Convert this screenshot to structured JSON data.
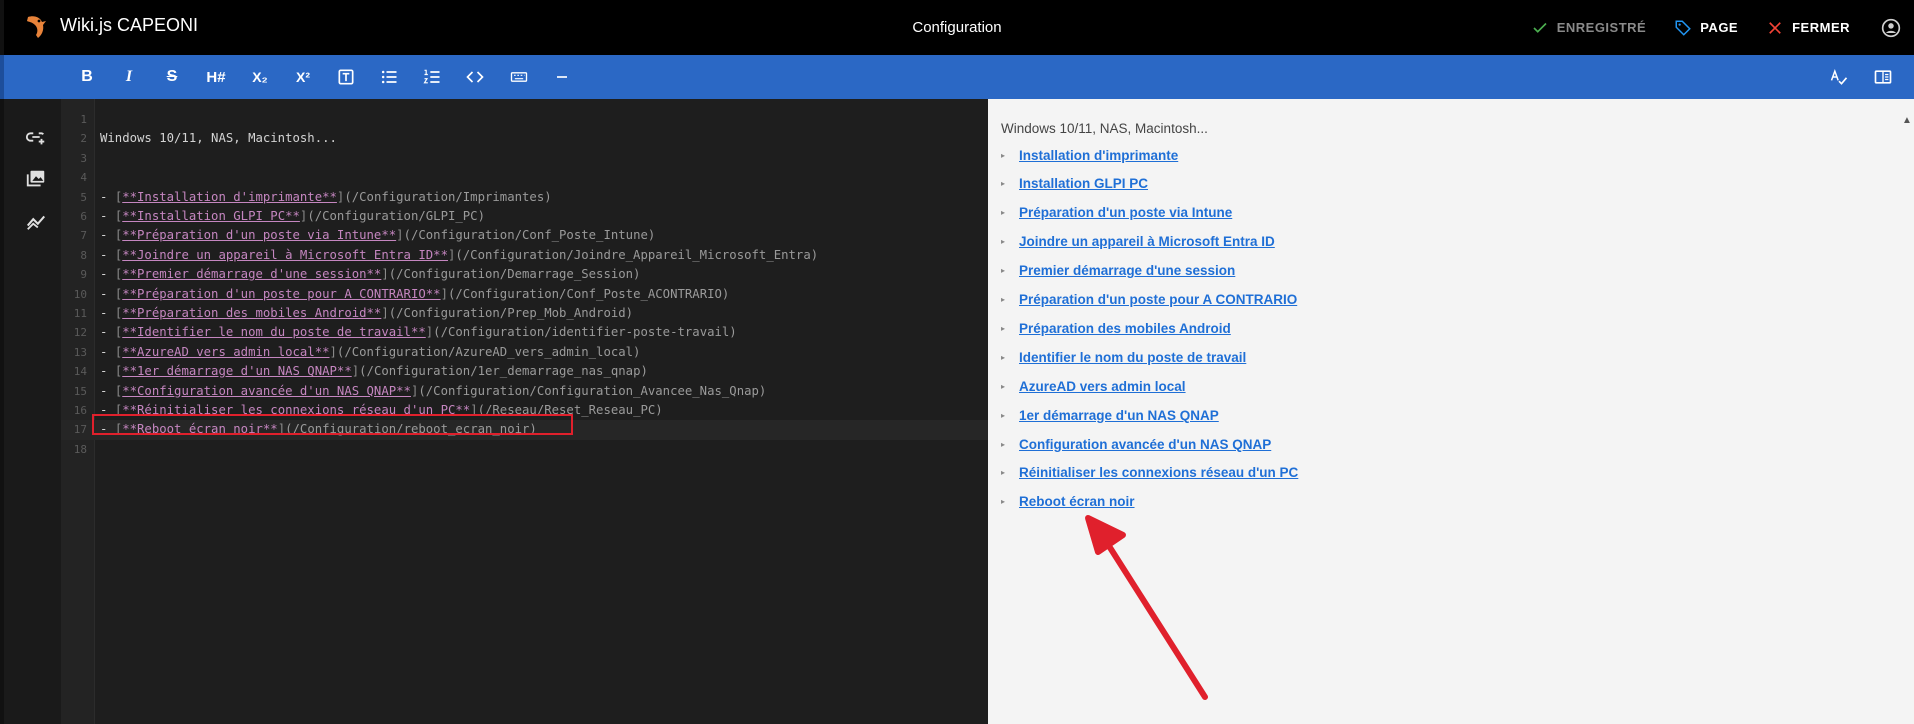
{
  "app": {
    "title": "Wiki.js CAPEONI",
    "page_title": "Configuration"
  },
  "top_actions": {
    "saved_label": "ENREGISTRÉ",
    "page_label": "PAGE",
    "close_label": "FERMER"
  },
  "toolbar": {
    "bold": "B",
    "italic": "I",
    "strikethrough": "S",
    "heading": "H#",
    "subscript": "X₂",
    "superscript": "X²",
    "blockquote": "T",
    "bullet_list": "bullet-list",
    "ordered_list": "ordered-list",
    "inline_code": "<>",
    "keyboard": "keyboard",
    "horizontal_rule": "—"
  },
  "editor": {
    "lines": [
      {
        "n": "1",
        "dash": "",
        "text": "",
        "url": ""
      },
      {
        "n": "2",
        "dash": "",
        "text": "Windows 10/11, NAS, Macintosh...",
        "url": ""
      },
      {
        "n": "3",
        "dash": "",
        "text": "",
        "url": ""
      },
      {
        "n": "4",
        "dash": "",
        "text": "",
        "url": ""
      },
      {
        "n": "5",
        "dash": "- ",
        "text": "**Installation d'imprimante**",
        "url": "(/Configuration/Imprimantes)"
      },
      {
        "n": "6",
        "dash": "- ",
        "text": "**Installation GLPI PC**",
        "url": "(/Configuration/GLPI_PC)"
      },
      {
        "n": "7",
        "dash": "- ",
        "text": "**Préparation d'un poste via Intune**",
        "url": "(/Configuration/Conf_Poste_Intune)"
      },
      {
        "n": "8",
        "dash": "- ",
        "text": "**Joindre un appareil à Microsoft Entra ID**",
        "url": "(/Configuration/Joindre_Appareil_Microsoft_Entra)"
      },
      {
        "n": "9",
        "dash": "- ",
        "text": "**Premier démarrage d'une session**",
        "url": "(/Configuration/Demarrage_Session)"
      },
      {
        "n": "10",
        "dash": "- ",
        "text": "**Préparation d'un poste pour A CONTRARIO**",
        "url": "(/Configuration/Conf_Poste_ACONTRARIO)"
      },
      {
        "n": "11",
        "dash": "- ",
        "text": "**Préparation des mobiles Android**",
        "url": "(/Configuration/Prep_Mob_Android)"
      },
      {
        "n": "12",
        "dash": "- ",
        "text": "**Identifier le nom du poste de travail**",
        "url": "(/Configuration/identifier-poste-travail)"
      },
      {
        "n": "13",
        "dash": "- ",
        "text": "**AzureAD vers admin local**",
        "url": "(/Configuration/AzureAD_vers_admin_local)"
      },
      {
        "n": "14",
        "dash": "- ",
        "text": "**1er démarrage d'un NAS QNAP**",
        "url": "(/Configuration/1er_demarrage_nas_qnap)"
      },
      {
        "n": "15",
        "dash": "- ",
        "text": "**Configuration avancée d'un NAS QNAP**",
        "url": "(/Configuration/Configuration_Avancee_Nas_Qnap)"
      },
      {
        "n": "16",
        "dash": "- ",
        "text": "**Réinitialiser les connexions réseau d'un PC**",
        "url": "(/Reseau/Reset_Reseau_PC)"
      },
      {
        "n": "17",
        "dash": "- ",
        "text": "**Reboot écran noir**",
        "url": "(/Configuration/reboot_ecran_noir)"
      },
      {
        "n": "18",
        "dash": "",
        "text": "",
        "url": ""
      }
    ]
  },
  "preview": {
    "intro": "Windows 10/11, NAS, Macintosh...",
    "links": [
      "Installation d'imprimante",
      "Installation GLPI PC",
      "Préparation d'un poste via Intune",
      "Joindre un appareil à Microsoft Entra ID",
      "Premier démarrage d'une session",
      "Préparation d'un poste pour A CONTRARIO",
      "Préparation des mobiles Android",
      "Identifier le nom du poste de travail",
      "AzureAD vers admin local",
      "1er démarrage d'un NAS QNAP",
      "Configuration avancée d'un NAS QNAP",
      "Réinitialiser les connexions réseau d'un PC",
      "Reboot écran noir"
    ]
  },
  "colors": {
    "toolbar_blue": "#2b68c5",
    "link_blue": "#1f6fd6",
    "annotation_red": "#e0202c",
    "saved_green": "#4caf50",
    "page_blue": "#2196f3"
  }
}
